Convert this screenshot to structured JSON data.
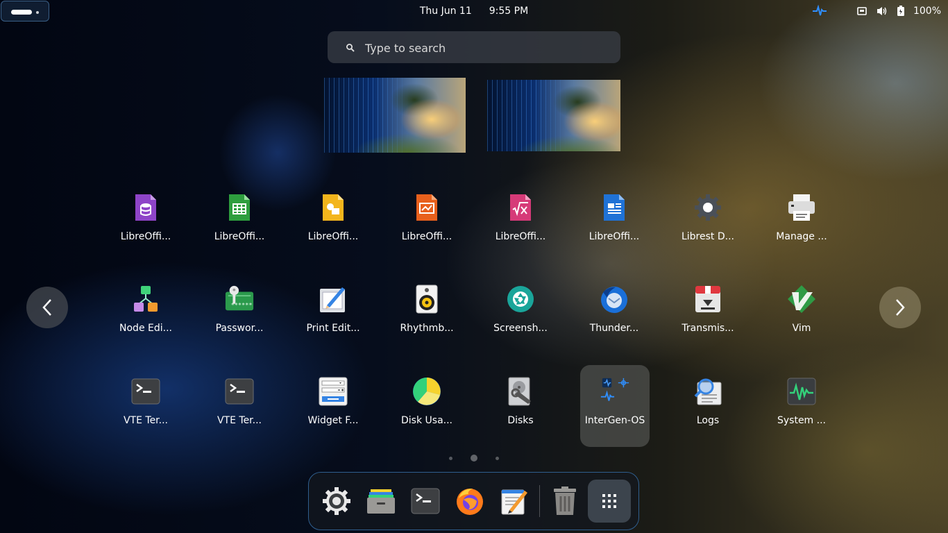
{
  "topbar": {
    "date": "Thu Jun 11",
    "time": "9:55 PM",
    "battery_percent": "100%",
    "tray_icons": [
      "intergen-pulse-icon",
      "network-icon",
      "volume-icon",
      "battery-icon"
    ]
  },
  "search": {
    "placeholder": "Type to search"
  },
  "apps": {
    "row1": [
      {
        "label": "LibreOffi...",
        "icon": "libreoffice-base-icon"
      },
      {
        "label": "LibreOffi...",
        "icon": "libreoffice-calc-icon"
      },
      {
        "label": "LibreOffi...",
        "icon": "libreoffice-draw-icon"
      },
      {
        "label": "LibreOffi...",
        "icon": "libreoffice-impress-icon"
      },
      {
        "label": "LibreOffi...",
        "icon": "libreoffice-math-icon"
      },
      {
        "label": "LibreOffi...",
        "icon": "libreoffice-writer-icon"
      },
      {
        "label": "Librest D...",
        "icon": "gear-icon"
      },
      {
        "label": "Manage ...",
        "icon": "printer-icon"
      }
    ],
    "row2": [
      {
        "label": "Node Edi...",
        "icon": "node-editor-icon"
      },
      {
        "label": "Passwor...",
        "icon": "password-key-icon"
      },
      {
        "label": "Print Edit...",
        "icon": "print-editor-icon"
      },
      {
        "label": "Rhythmb...",
        "icon": "rhythmbox-speaker-icon"
      },
      {
        "label": "Screensh...",
        "icon": "camera-shutter-icon"
      },
      {
        "label": "Thunder...",
        "icon": "thunderbird-icon"
      },
      {
        "label": "Transmis...",
        "icon": "transmission-icon"
      },
      {
        "label": "Vim",
        "icon": "vim-icon"
      }
    ],
    "row3": [
      {
        "label": "VTE Ter...",
        "icon": "terminal-icon"
      },
      {
        "label": "VTE Ter...",
        "icon": "terminal-icon"
      },
      {
        "label": "Widget F...",
        "icon": "widget-factory-icon"
      },
      {
        "label": "Disk Usa...",
        "icon": "disk-usage-pie-icon"
      },
      {
        "label": "Disks",
        "icon": "disks-icon"
      },
      {
        "label": "InterGen-OS",
        "icon": "intergen-os-icon"
      },
      {
        "label": "Logs",
        "icon": "logs-icon"
      },
      {
        "label": "System ...",
        "icon": "system-monitor-icon"
      }
    ]
  },
  "dash": {
    "items": [
      "settings-icon",
      "files-icon",
      "terminal-icon",
      "firefox-icon",
      "text-editor-icon",
      "trash-icon",
      "show-apps-icon"
    ]
  },
  "pages": {
    "count": 3,
    "current": 2
  },
  "colors": {
    "accent": "#3584e4",
    "dash_border": "#2f5e8e",
    "topbar_accent": "#2f8fff"
  }
}
